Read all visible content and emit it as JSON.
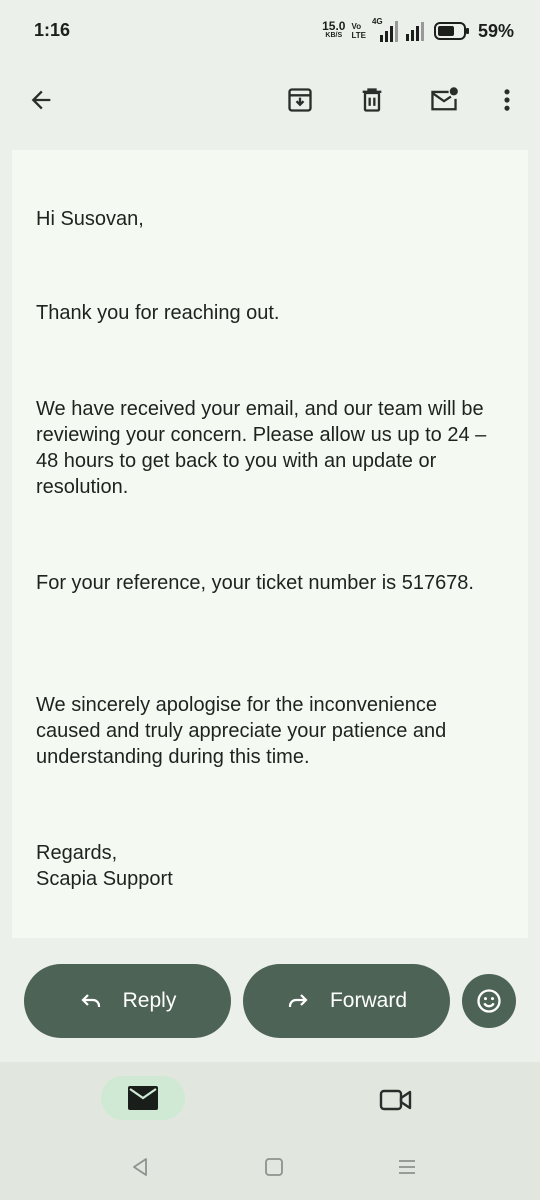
{
  "status_bar": {
    "time": "1:16",
    "net_speed_value": "15.0",
    "net_speed_unit": "KB/S",
    "volte_top": "Vo",
    "volte_bottom": "LTE",
    "network_type": "4G",
    "battery_percent": "59%"
  },
  "app_bar": {
    "icons": [
      "back-arrow-icon",
      "archive-icon",
      "delete-icon",
      "mark-unread-icon",
      "more-vert-icon"
    ]
  },
  "email": {
    "greeting": "Hi Susovan,",
    "para1": "Thank you for reaching out.",
    "para2": "We have received your email, and our team will be reviewing your concern. Please allow us up to 24 – 48 hours to get back to you with an update or resolution.",
    "para3": "For your reference, your ticket number is 517678.",
    "para4": "We sincerely apologise for the inconvenience caused and truly appreciate your patience and understanding during this time.",
    "sign_line1": "Regards,",
    "sign_line2": "Scapia Support"
  },
  "actions": {
    "reply_label": "Reply",
    "forward_label": "Forward"
  },
  "colors": {
    "button_bg": "#4c6355",
    "card_bg": "#f4f9f2",
    "page_bg": "#ecf0ea",
    "nav_active_bg": "#cfe9d4"
  }
}
